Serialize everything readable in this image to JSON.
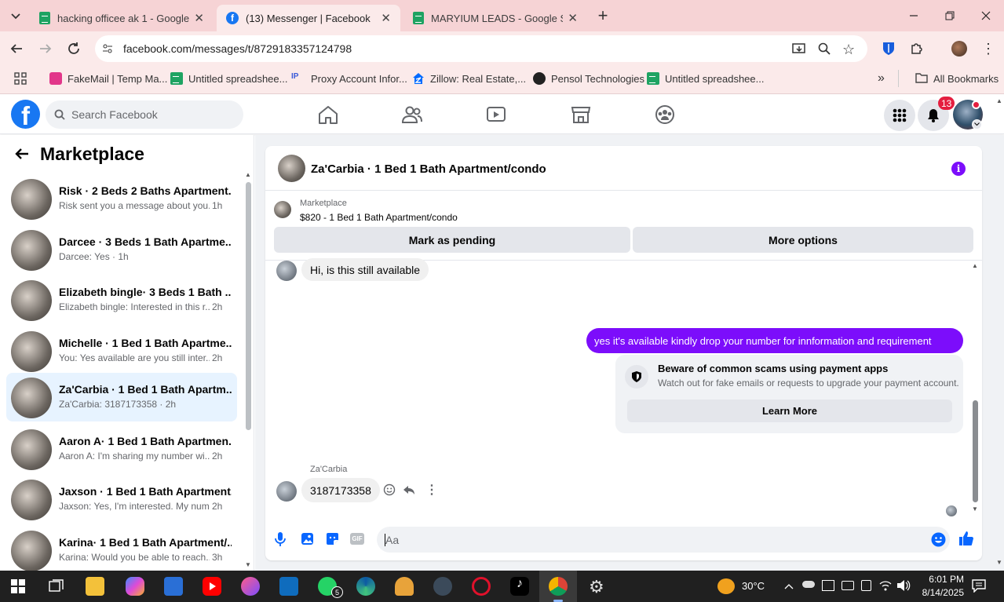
{
  "browser": {
    "tabs": [
      {
        "title": "hacking officee ak 1 - Google Sh",
        "icon": "sheets-icon"
      },
      {
        "title": "(13) Messenger | Facebook",
        "icon": "facebook-icon"
      },
      {
        "title": "MARYIUM LEADS - Google Shee",
        "icon": "sheets-icon"
      }
    ],
    "tab_close": "✕",
    "new_tab": "+",
    "url": "facebook.com/messages/t/8729183357124798",
    "bookmarks": [
      {
        "label": "FakeMail | Temp Ma...",
        "icon": "fakemail-icon"
      },
      {
        "label": "Untitled spreadshee...",
        "icon": "sheets-icon"
      },
      {
        "label": "Proxy Account Infor...",
        "icon": "proxy-icon"
      },
      {
        "label": "Zillow: Real Estate,...",
        "icon": "zillow-icon"
      },
      {
        "label": "Pensol Technologies",
        "icon": "pensol-icon"
      },
      {
        "label": "Untitled spreadshee...",
        "icon": "sheets-icon"
      }
    ],
    "more_bookmarks": "»",
    "all_bookmarks": "All Bookmarks"
  },
  "facebook": {
    "logo": "f",
    "search_placeholder": "Search Facebook",
    "notification_count": "13",
    "colors": {
      "brand": "#1877f2",
      "sent_bubble": "#7c0dfb",
      "selected": "#e7f3ff"
    }
  },
  "sidebar": {
    "title": "Marketplace",
    "conversations": [
      {
        "name": "Risk · 2 Beds 2 Baths Apartment...",
        "preview": "Risk sent you a message about you...",
        "time": "1h",
        "selected": false
      },
      {
        "name": "Darcee · 3 Beds 1 Bath Apartme...",
        "preview": "Darcee: Yes · 1h",
        "time": "",
        "selected": false
      },
      {
        "name": "Elizabeth bingle· 3 Beds 1 Bath ...",
        "preview": "Elizabeth bingle: Interested in this r...",
        "time": "2h",
        "selected": false
      },
      {
        "name": "Michelle · 1 Bed 1 Bath Apartme...",
        "preview": "You: Yes available are you still inter...",
        "time": "2h",
        "selected": false
      },
      {
        "name": "Za'Carbia · 1 Bed 1 Bath Apartm...",
        "preview": "Za'Carbia: 3187173358 · 2h",
        "time": "",
        "selected": true
      },
      {
        "name": "Aaron A· 1 Bed 1 Bath Apartmen...",
        "preview": "Aaron A: I'm sharing my number wi...",
        "time": "2h",
        "selected": false
      },
      {
        "name": "Jaxson · 1 Bed 1 Bath Apartment...",
        "preview": "Jaxson: Yes, I'm interested. My num...",
        "time": "2h",
        "selected": false
      },
      {
        "name": "Karina· 1 Bed 1 Bath Apartment/...",
        "preview": "Karina: Would you be able to reach...",
        "time": "3h",
        "selected": false
      }
    ]
  },
  "chat": {
    "title": "Za'Carbia · 1 Bed 1 Bath Apartment/condo",
    "listing_source": "Marketplace",
    "listing_summary": "$820 - 1 Bed 1 Bath Apartment/condo",
    "mark_pending": "Mark as pending",
    "more_options": "More options",
    "messages": {
      "first": "Hi, is this still available",
      "sent": "yes it's available kindly drop your  number for  innformation and requirement",
      "reply_sender": "Za'Carbia",
      "reply": "3187173358"
    },
    "scam_notice": {
      "title": "Beware of common scams using payment apps",
      "body": "Watch out for fake emails or requests to upgrade your payment account.",
      "button": "Learn More"
    },
    "composer_placeholder": "Aa"
  },
  "taskbar": {
    "whatsapp_badge": "5",
    "weather": "30°C",
    "time": "6:01 PM",
    "date": "8/14/2025"
  }
}
